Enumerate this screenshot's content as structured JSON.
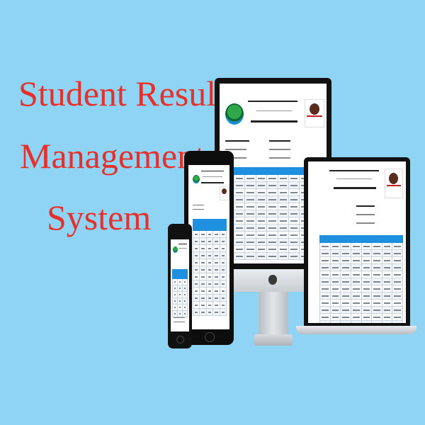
{
  "headline": {
    "line1": "Student Result",
    "line2": "Management",
    "line3": "System"
  },
  "colors": {
    "background": "#8fd4f5",
    "headline": "#e8302a",
    "table_header": "#1f8fe0"
  },
  "devices": [
    "desktop-monitor",
    "laptop",
    "tablet",
    "smartphone"
  ],
  "icons": [
    "apple-logo-icon",
    "school-logo-icon",
    "student-photo-icon"
  ]
}
